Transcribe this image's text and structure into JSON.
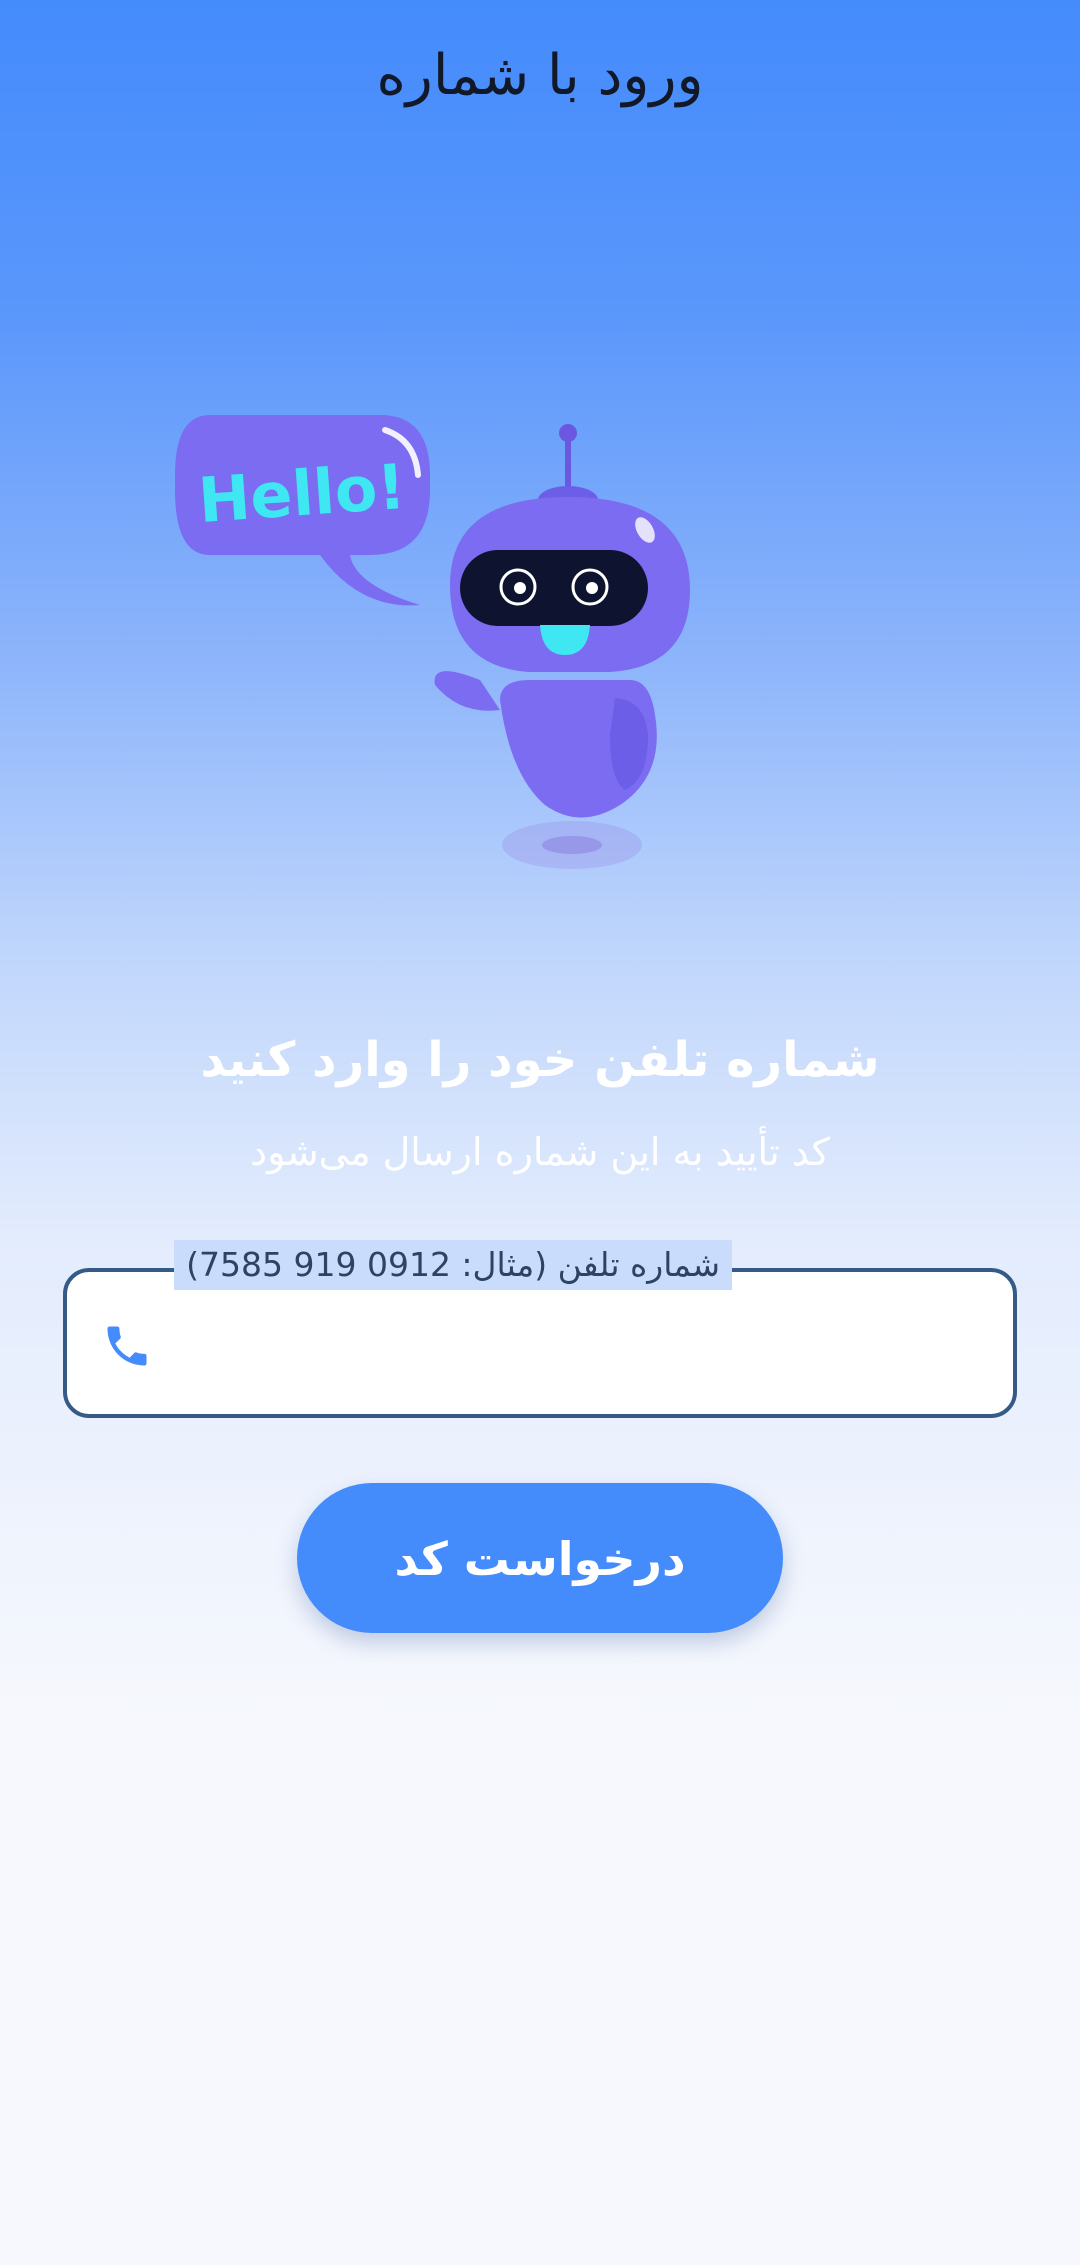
{
  "header": {
    "title": "ورود با شماره"
  },
  "illustration": {
    "bubble_text": "Hello!",
    "icon": "robot-illustration"
  },
  "main": {
    "headline": "شماره تلفن خود را وارد کنید",
    "subline": "کد تأیید به این شماره ارسال می‌شود",
    "phone_field": {
      "label": "شماره تلفن (مثال: 0912 919 7585)",
      "value": "",
      "icon": "phone-icon"
    },
    "request_button_label": "درخواست کد"
  },
  "colors": {
    "accent": "#448bfc",
    "field_border": "#355a86",
    "robot": "#7b6cf2",
    "bubble_text": "#3fe7f2"
  }
}
